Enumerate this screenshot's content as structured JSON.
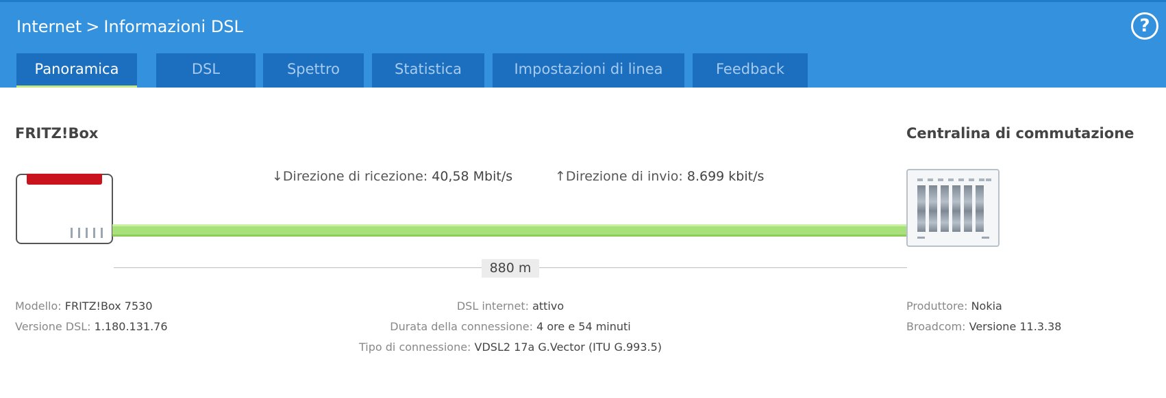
{
  "header": {
    "breadcrumb": [
      "Internet",
      "Informazioni DSL"
    ],
    "separator": ">",
    "help_icon": "?"
  },
  "tabs": [
    {
      "label": "Panoramica",
      "active": true
    },
    {
      "label": "DSL",
      "active": false
    },
    {
      "label": "Spettro",
      "active": false
    },
    {
      "label": "Statistica",
      "active": false
    },
    {
      "label": "Impostazioni di linea",
      "active": false
    },
    {
      "label": "Feedback",
      "active": false
    }
  ],
  "overview": {
    "left_title": "FRITZ!Box",
    "right_title": "Centralina di commutazione",
    "downstream": {
      "label": "↓Direzione di ricezione:",
      "value": "40,58 Mbit/s"
    },
    "upstream": {
      "label": "↑Direzione di invio:",
      "value": "8.699 kbit/s"
    },
    "distance": "880 m"
  },
  "info_left": [
    {
      "label": "Modello:",
      "value": "FRITZ!Box 7530"
    },
    {
      "label": "Versione DSL:",
      "value": "1.180.131.76"
    }
  ],
  "info_center": [
    {
      "label": "DSL internet:",
      "value": "attivo"
    },
    {
      "label": "Durata della connessione:",
      "value": "4 ore e 54 minuti"
    },
    {
      "label": "Tipo di connessione:",
      "value": "VDSL2 17a G.Vector (ITU G.993.5)"
    }
  ],
  "info_right": [
    {
      "label": "Produttore:",
      "value": "Nokia"
    },
    {
      "label": "Broadcom:",
      "value": "Versione 11.3.38"
    }
  ],
  "colors": {
    "header_bg": "#3391de",
    "tab_bg": "#1c6fbe",
    "active_underline": "#c4e880",
    "line_green": "#a8e07a",
    "router_red": "#c9131d"
  }
}
